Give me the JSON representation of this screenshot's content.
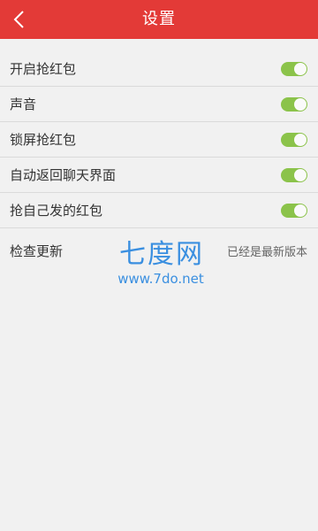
{
  "header": {
    "title": "设置",
    "back_icon": "chevron-left-icon",
    "bg_color": "#e33a37"
  },
  "settings": [
    {
      "label": "开启抢红包",
      "enabled": true
    },
    {
      "label": "声音",
      "enabled": true
    },
    {
      "label": "锁屏抢红包",
      "enabled": true
    },
    {
      "label": "自动返回聊天界面",
      "enabled": true
    },
    {
      "label": "抢自己发的红包",
      "enabled": true
    }
  ],
  "update": {
    "label": "检查更新",
    "status": "已经是最新版本"
  },
  "watermark": {
    "logo_text": "七度网",
    "url": "www.7do.net"
  },
  "colors": {
    "toggle_on": "#8bc34a",
    "watermark": "#3a8fe0"
  }
}
